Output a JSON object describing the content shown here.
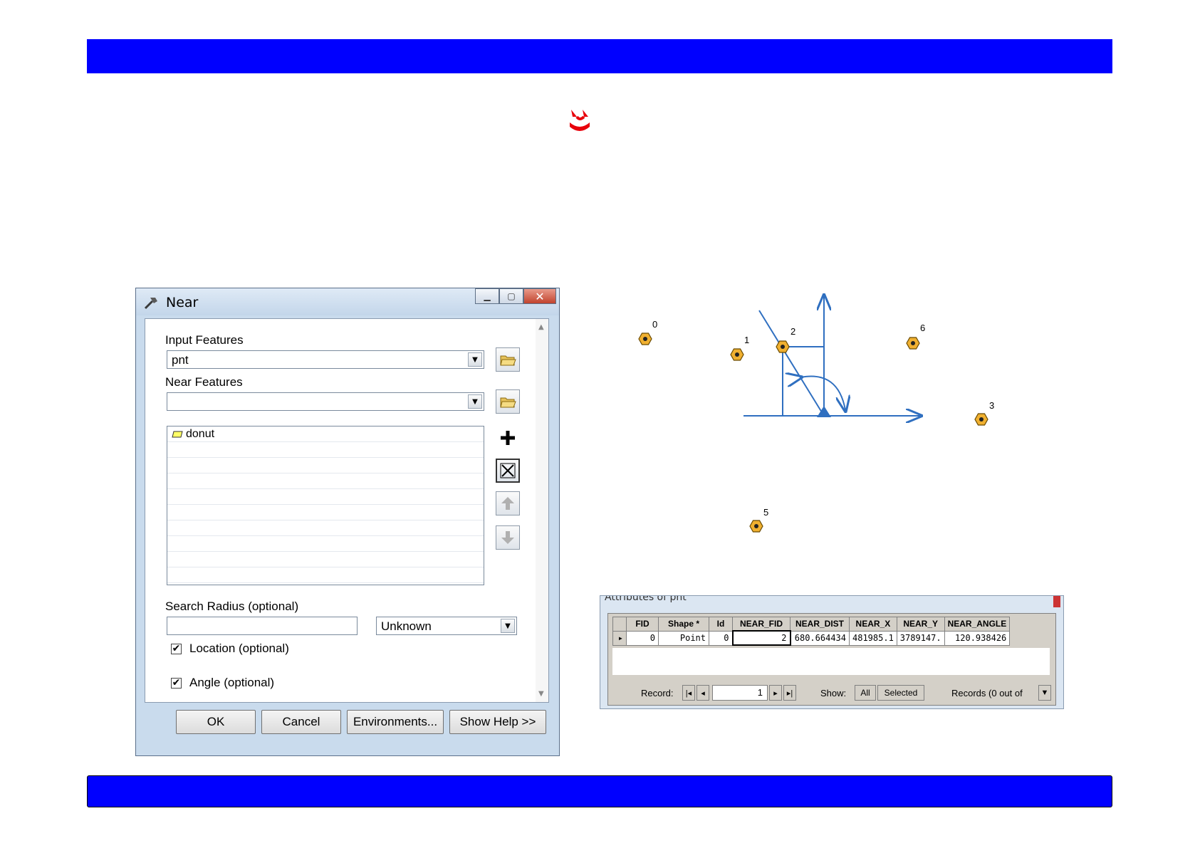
{
  "slide": {
    "top_band_color": "#0000ff",
    "bottom_band_color": "#0000ff",
    "logo_color": "#e8000b"
  },
  "dialog": {
    "title": "Near",
    "input_features_label": "Input Features",
    "input_features_value": "pnt",
    "near_features_label": "Near Features",
    "near_features_value": "",
    "near_list": [
      "donut"
    ],
    "search_radius_label": "Search Radius (optional)",
    "search_radius_value": "",
    "units_value": "Unknown",
    "location_label": "Location (optional)",
    "location_checked": true,
    "angle_label": "Angle (optional)",
    "angle_checked": true,
    "buttons": {
      "ok": "OK",
      "cancel": "Cancel",
      "environments": "Environments...",
      "show_help": "Show Help >>"
    },
    "check_mark": "✔"
  },
  "map": {
    "point_labels": [
      "0",
      "1",
      "2",
      "6",
      "3",
      "5"
    ],
    "point_color": "#f0b030",
    "line_color": "#2f6fc0"
  },
  "attributes": {
    "title": "Attributes of pnt",
    "columns": [
      "FID",
      "Shape *",
      "Id",
      "NEAR_FID",
      "NEAR_DIST",
      "NEAR_X",
      "NEAR_Y",
      "NEAR_ANGLE"
    ],
    "rows": [
      [
        "0",
        "Point",
        "0",
        "2",
        "680.664434",
        "481985.1",
        "3789147.",
        "120.938426"
      ]
    ],
    "record_label": "Record:",
    "record_value": "1",
    "show_label": "Show:",
    "all_label": "All",
    "selected_label": "Selected",
    "records_text": "Records (0 out of"
  }
}
